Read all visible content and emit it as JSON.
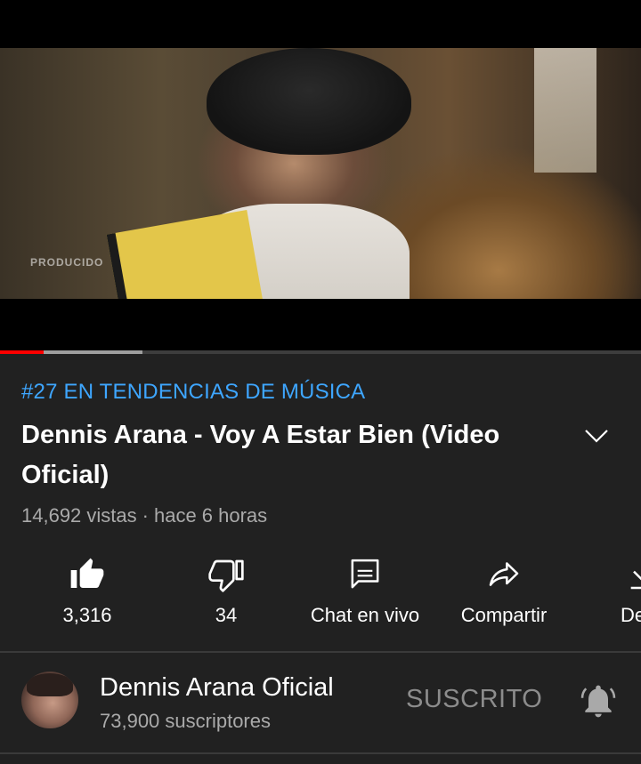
{
  "video": {
    "watermark": "PRODUCIDO",
    "progress": {
      "played_fraction": 0.068,
      "buffered_fraction": 0.222
    }
  },
  "trending_label": "#27 EN TENDENCIAS DE MÚSICA",
  "title": "Dennis Arana - Voy A Estar Bien (Video Oficial)",
  "meta": {
    "views": "14,692 vistas",
    "separator": "·",
    "age": "hace 6 horas"
  },
  "actions": [
    {
      "icon": "thumbs-up-icon",
      "label": "3,316"
    },
    {
      "icon": "thumbs-down-icon",
      "label": "34"
    },
    {
      "icon": "live-chat-icon",
      "label": "Chat en vivo"
    },
    {
      "icon": "share-icon",
      "label": "Compartir"
    },
    {
      "icon": "download-icon",
      "label": "Desc"
    }
  ],
  "channel": {
    "name": "Dennis Arana Oficial",
    "subscribers": "73,900 suscriptores",
    "subscribe_state": "SUSCRITO",
    "bell_icon": "notification-bell-icon"
  },
  "colors": {
    "background": "#212121",
    "trending": "#3ea6ff",
    "progress_played": "#ff0000",
    "secondary_text": "#aaaaaa"
  }
}
